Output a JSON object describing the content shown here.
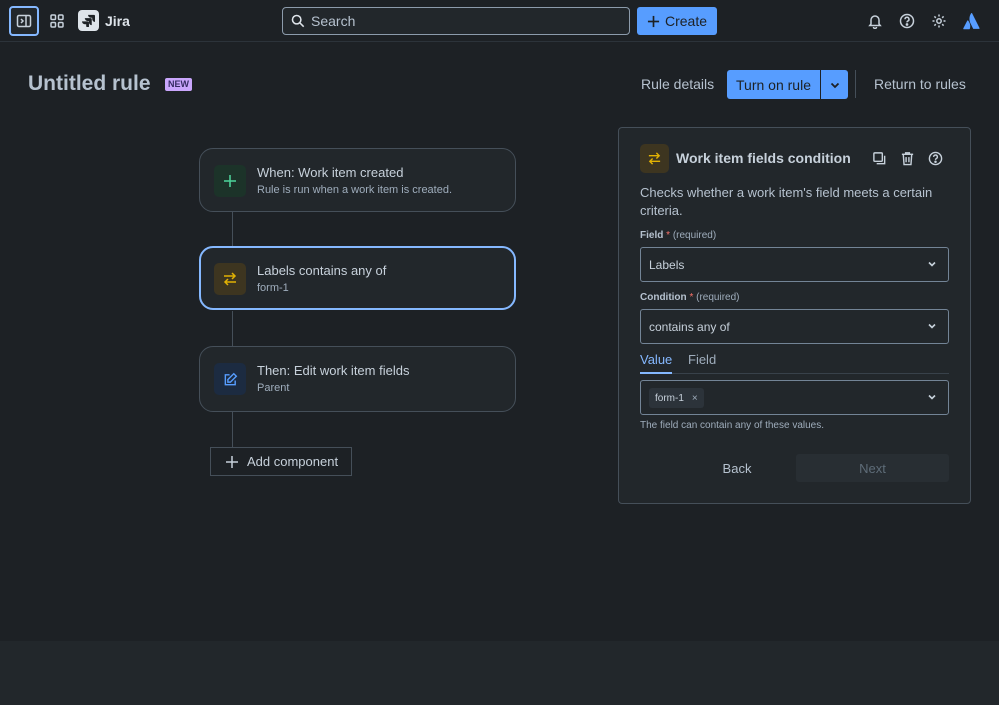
{
  "nav": {
    "app_name": "Jira",
    "search_placeholder": "Search",
    "create_label": "Create",
    "icons": [
      "sidebar-toggle-icon",
      "app-switcher-icon",
      "notifications-icon",
      "help-icon",
      "settings-icon",
      "atlassian-logo-icon"
    ]
  },
  "header": {
    "title": "Untitled rule",
    "badge": "NEW",
    "rule_details_label": "Rule details",
    "turn_on_label": "Turn on rule",
    "return_label": "Return to rules"
  },
  "flow": {
    "trigger": {
      "title": "When: Work item created",
      "subtitle": "Rule is run when a work item is created."
    },
    "condition": {
      "title": "Labels contains any of",
      "subtitle": "form-1"
    },
    "action": {
      "title": "Then: Edit work item fields",
      "subtitle": "Parent"
    },
    "add_component_label": "Add component"
  },
  "panel": {
    "title": "Work item fields condition",
    "description": "Checks whether a work item's field meets a certain criteria.",
    "field": {
      "label": "Field",
      "required_mark": "*",
      "hint": "(required)",
      "value": "Labels"
    },
    "condition": {
      "label": "Condition",
      "required_mark": "*",
      "hint": "(required)",
      "value": "contains any of"
    },
    "tabs": [
      "Value",
      "Field"
    ],
    "value_tag": "form-1",
    "tag_remove": "×",
    "helper": "The field can contain any of these values.",
    "back_label": "Back",
    "next_label": "Next"
  },
  "colors": {
    "background": "#1d2125",
    "accent": "#579dff",
    "selected_border": "#85b8ff",
    "badge_bg": "#c9a6fc",
    "trigger_icon": "#4bce97",
    "condition_icon": "#e2b203",
    "action_icon": "#579dff"
  }
}
